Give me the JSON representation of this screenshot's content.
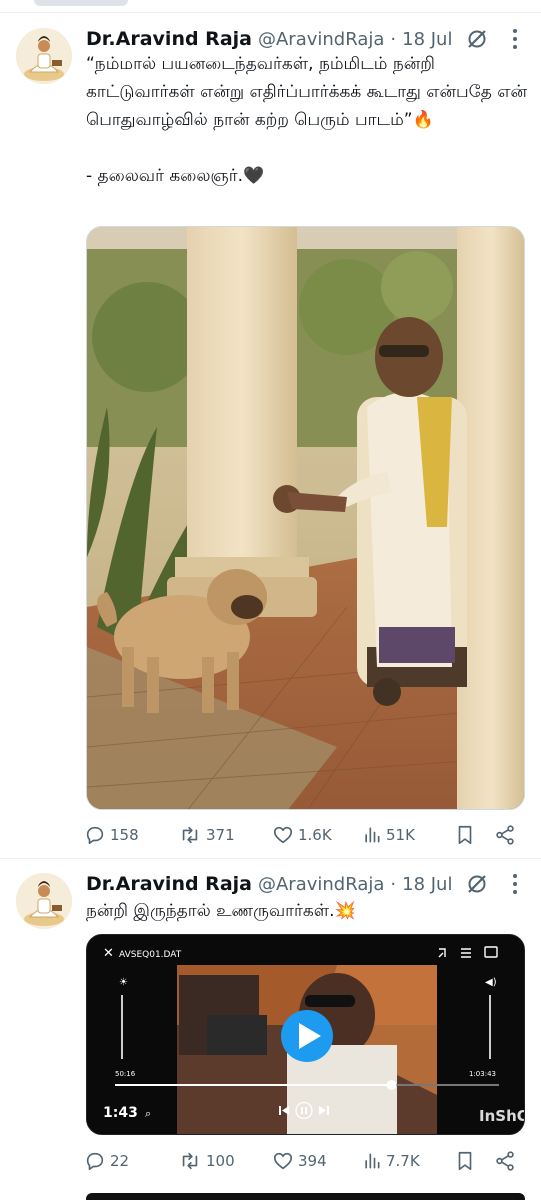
{
  "tweets": [
    {
      "author_name": "Dr.Aravind Raja",
      "handle": "@AravindRaja",
      "dot": "·",
      "date": "18 Jul",
      "text": "“நம்மால் பயனடைந்தவர்கள், நம்மிடம் நன்றி காட்டுவார்கள் என்று எதிர்ப்பார்க்கக் கூடாது என்பதே என் பொதுவாழ்வில் நான் கற்ற பெரும் பாடம்”🔥\n\n- தலைவர் கலைஞர்.🖤",
      "stats": {
        "replies": "158",
        "reposts": "371",
        "likes": "1.6K",
        "views": "51K"
      }
    },
    {
      "author_name": "Dr.Aravind Raja",
      "handle": "@AravindRaja",
      "dot": "·",
      "date": "18 Jul",
      "text": "நன்றி இருந்தால் உணருவார்கள்.💥",
      "stats": {
        "replies": "22",
        "reposts": "100",
        "likes": "394",
        "views": "7.7K"
      },
      "video": {
        "filename": "AVSEQ01.DAT",
        "elapsed_small": "50:16",
        "total_small": "1:03:43",
        "duration": "1:43",
        "watermark": "InShOt",
        "progress": 0.72
      }
    }
  ],
  "icons": {
    "reply": "reply-icon",
    "repost": "repost-icon",
    "like": "heart-icon",
    "views": "views-icon",
    "bookmark": "bookmark-icon",
    "share": "share-icon",
    "grok": "grok-icon",
    "more": "more-icon"
  },
  "colors": {
    "text": "#0f1419",
    "muted": "#536471",
    "accent": "#1d9bf0",
    "divider": "#eff3f4"
  }
}
